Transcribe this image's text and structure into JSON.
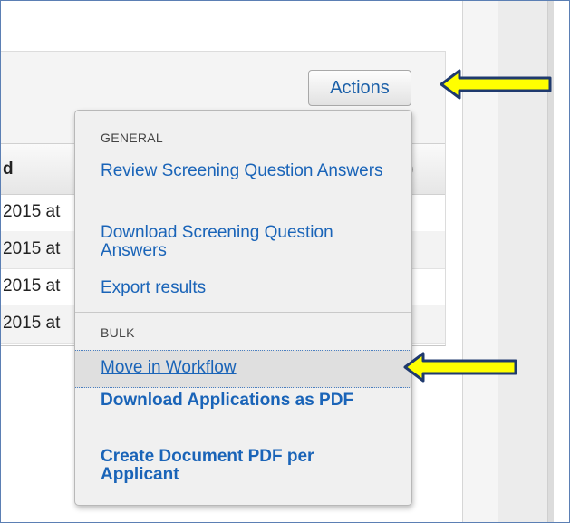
{
  "toolbar": {
    "actions_label": "Actions"
  },
  "table": {
    "header_left": "d",
    "header_right": ")",
    "rows": [
      "2015 at",
      "2015 at",
      "2015 at",
      "2015 at"
    ]
  },
  "menu": {
    "general_label": "GENERAL",
    "review_label": "Review Screening Question Answers",
    "download_label": "Download Screening Question Answers",
    "export_label": "Export results",
    "bulk_label": "BULK",
    "move_label": "Move in Workflow",
    "download_apps_label": "Download Applications as PDF",
    "create_pdf_label": "Create Document PDF per Applicant"
  },
  "annotations": {
    "arrow_color": "#ffff00",
    "arrow_outline": "#1f3a6e"
  },
  "colors": {
    "link": "#1a64b8",
    "frame": "#5b7fb4"
  }
}
